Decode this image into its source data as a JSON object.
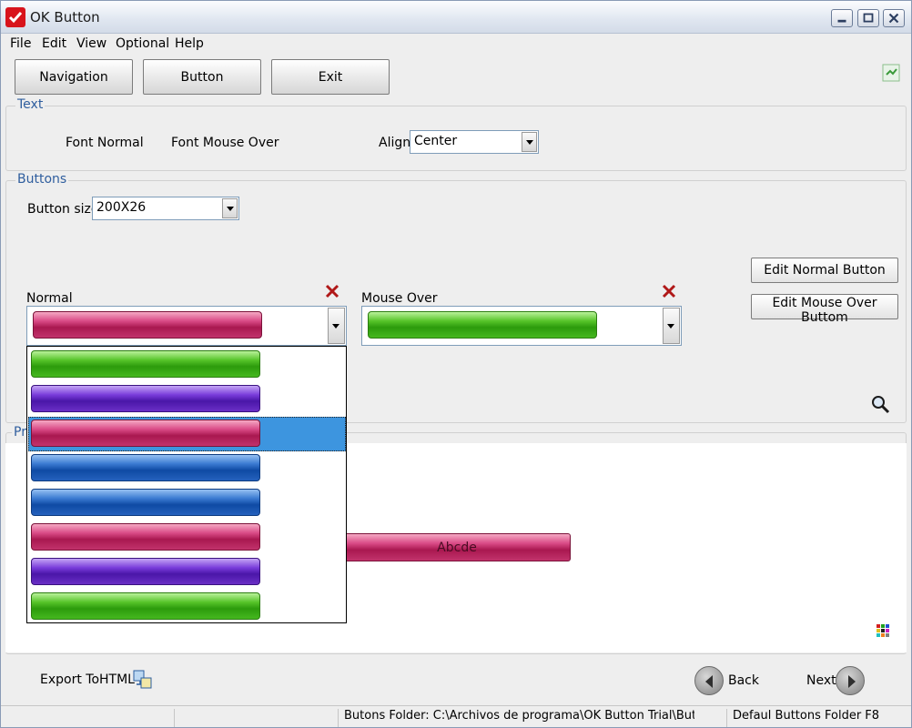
{
  "window": {
    "title": "OK Button"
  },
  "menu": [
    "File",
    "Edit",
    "View",
    "Optional",
    "Help"
  ],
  "toolbar": {
    "navigation": "Navigation",
    "button": "Button",
    "exit": "Exit"
  },
  "text_group": {
    "legend": "Text",
    "font_normal": "Font Normal",
    "font_mouse_over": "Font Mouse Over",
    "align_label": "Align",
    "align_value": "Center"
  },
  "buttons_group": {
    "legend": "Buttons",
    "size_label": "Button size:",
    "size_value": "200X26",
    "normal_label": "Normal",
    "mouse_over_label": "Mouse Over",
    "edit_normal": "Edit Normal Button",
    "edit_mouse_over": "Edit Mouse Over Buttom"
  },
  "dropdown": {
    "items": [
      "green",
      "purple",
      "pink",
      "blue",
      "blue",
      "pink",
      "purple",
      "green"
    ],
    "selected_index": 2
  },
  "preview": {
    "legend_fragment": "Pr",
    "button_text": "Abcde"
  },
  "bottom": {
    "export": "Export ToHTML",
    "back": "Back",
    "next": "Next"
  },
  "status": {
    "folder": "Butons Folder: C:\\Archivos de programa\\OK Button Trial\\Buttor",
    "default": "Defaul Buttons Folder F8"
  },
  "colors": {
    "legend": "#2f5e9e",
    "selection": "#3d95df",
    "close_x": "#b01818"
  }
}
